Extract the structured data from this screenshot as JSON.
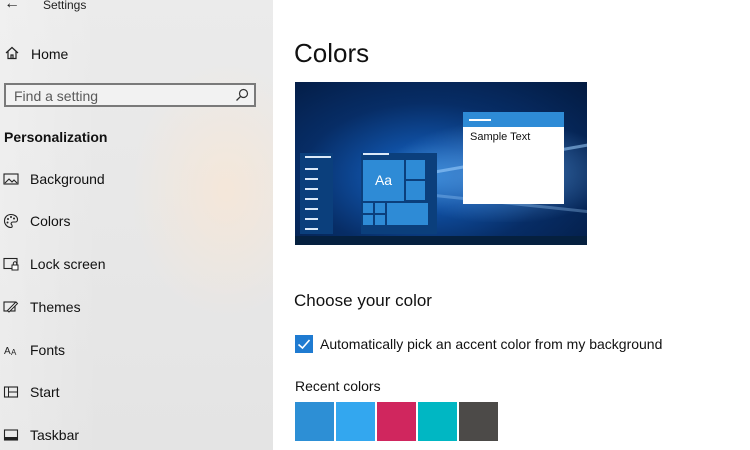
{
  "app": {
    "title": "Settings"
  },
  "sidebar": {
    "home_label": "Home",
    "search_placeholder": "Find a setting",
    "section_title": "Personalization",
    "items": [
      {
        "label": "Background",
        "icon": "picture-icon"
      },
      {
        "label": "Colors",
        "icon": "palette-icon"
      },
      {
        "label": "Lock screen",
        "icon": "lock-screen-icon"
      },
      {
        "label": "Themes",
        "icon": "themes-icon"
      },
      {
        "label": "Fonts",
        "icon": "fonts-icon"
      },
      {
        "label": "Start",
        "icon": "start-icon"
      },
      {
        "label": "Taskbar",
        "icon": "taskbar-icon"
      }
    ]
  },
  "main": {
    "title": "Colors",
    "preview": {
      "sample_text": "Sample Text",
      "tile_text": "Aa"
    },
    "choose_title": "Choose your color",
    "auto_accent": {
      "label": "Automatically pick an accent color from my background",
      "checked": true
    },
    "recent_label": "Recent colors",
    "recent_colors": [
      "#2d8fd5",
      "#33a7ef",
      "#d0265e",
      "#00b7c3",
      "#4c4a48"
    ]
  },
  "colors": {
    "accent": "#1f7bd1"
  }
}
